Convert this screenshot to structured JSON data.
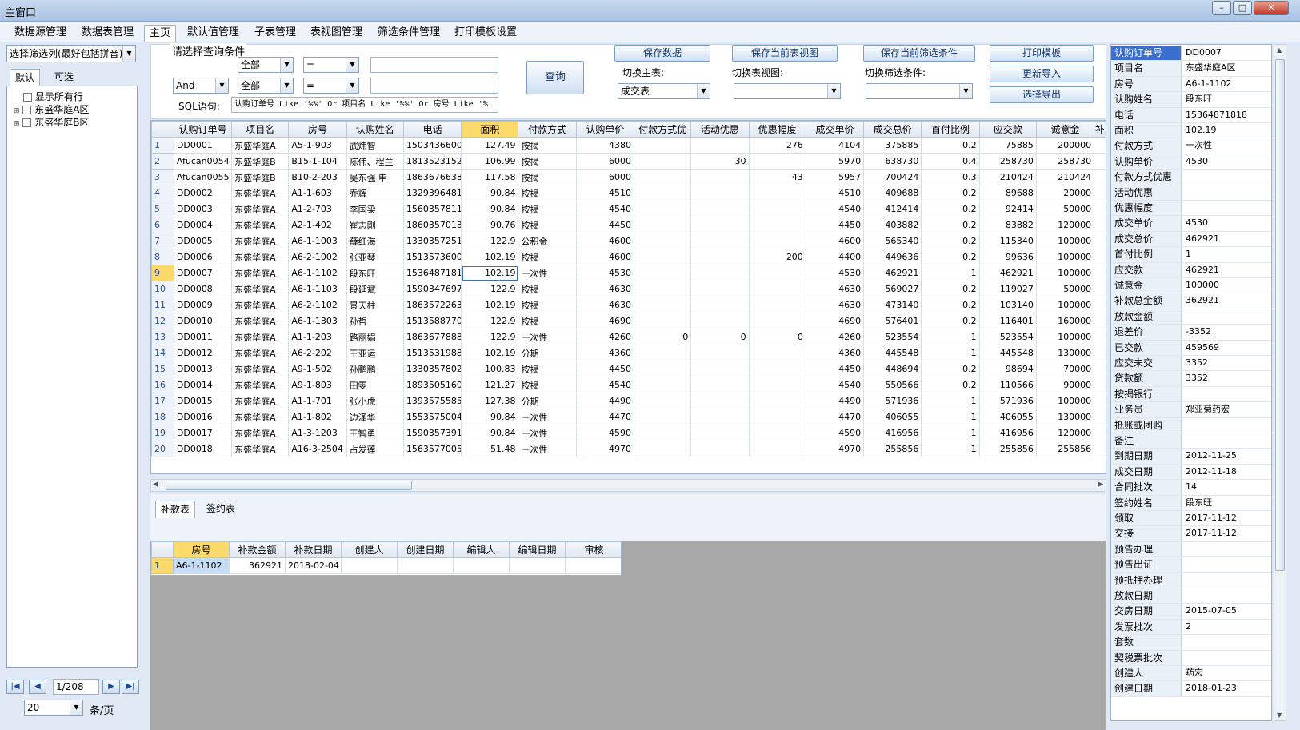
{
  "window": {
    "title": "主窗口"
  },
  "menu": {
    "items": [
      "数据源管理",
      "数据表管理",
      "主页",
      "默认值管理",
      "子表管理",
      "表视图管理",
      "筛选条件管理",
      "打印模板设置"
    ],
    "active": 2
  },
  "left": {
    "filter_select": "选择筛选列(最好包括拼音)",
    "tabs": [
      "默认",
      "可选"
    ],
    "tree": [
      "显示所有行",
      "东盛华庭A区",
      "东盛华庭B区"
    ],
    "pager": {
      "page": "1/208",
      "page_size": "20",
      "unit": "条/页"
    }
  },
  "query": {
    "legend": "请选择查询条件",
    "row1": {
      "field": "全部",
      "op": "=",
      "value": ""
    },
    "row2": {
      "logic": "And",
      "field": "全部",
      "op": "=",
      "value": ""
    },
    "sql_label": "SQL语句:",
    "sql_value": "认购订单号 Like '%%' Or 项目名 Like '%%' Or 房号 Like '%",
    "query_button": "查询"
  },
  "toolbar": {
    "save_data": "保存数据",
    "save_view": "保存当前表视图",
    "save_filter": "保存当前筛选条件",
    "print_template": "打印模板",
    "update_import": "更新导入",
    "select_export": "选择导出",
    "switch_main_label": "切换主表:",
    "switch_main_value": "成交表",
    "switch_view_label": "切换表视图:",
    "switch_view_value": "",
    "switch_filter_label": "切换筛选条件:",
    "switch_filter_value": ""
  },
  "grid": {
    "columns": [
      "认购订单号",
      "项目名",
      "房号",
      "认购姓名",
      "电话",
      "面积",
      "付款方式",
      "认购单价",
      "付款方式优",
      "活动优惠",
      "优惠幅度",
      "成交单价",
      "成交总价",
      "首付比例",
      "应交款",
      "诚意金",
      "补款总金"
    ],
    "highlight_col": 5,
    "current_row": 9,
    "rows": [
      [
        "1",
        "DD0001",
        "东盛华庭A",
        "A5-1-903",
        "武炜智",
        "1503436600",
        "127.49",
        "按揭",
        "4380",
        "",
        "",
        "276",
        "4104",
        "375885",
        "0.2",
        "75885",
        "200000",
        "8"
      ],
      [
        "2",
        "Afucan0054",
        "东盛华庭B",
        "B15-1-104",
        "陈伟、程兰",
        "1813523152",
        "106.99",
        "按揭",
        "6000",
        "",
        "30",
        "",
        "5970",
        "638730",
        "0.4",
        "258730",
        "258730",
        ""
      ],
      [
        "3",
        "Afucan0055",
        "东盛华庭B",
        "B10-2-203",
        "吴东强 申",
        "1863676638",
        "117.58",
        "按揭",
        "6000",
        "",
        "",
        "43",
        "5957",
        "700424",
        "0.3",
        "210424",
        "210424",
        ""
      ],
      [
        "4",
        "DD0002",
        "东盛华庭A",
        "A1-1-603",
        "乔辉",
        "1329396481",
        "90.84",
        "按揭",
        "4510",
        "",
        "",
        "",
        "4510",
        "409688",
        "0.2",
        "89688",
        "20000",
        "229"
      ],
      [
        "5",
        "DD0003",
        "东盛华庭A",
        "A1-2-703",
        "李国梁",
        "1560357811",
        "90.84",
        "按揭",
        "4540",
        "",
        "",
        "",
        "4540",
        "412414",
        "0.2",
        "92414",
        "50000",
        "82"
      ],
      [
        "6",
        "DD0004",
        "东盛华庭A",
        "A2-1-402",
        "崔志刚",
        "1860357013",
        "90.76",
        "按揭",
        "4450",
        "",
        "",
        "",
        "4450",
        "403882",
        "0.2",
        "83882",
        "120000",
        "3"
      ],
      [
        "7",
        "DD0005",
        "东盛华庭A",
        "A6-1-1003",
        "薛红海",
        "1330357251",
        "122.9",
        "公积金",
        "4600",
        "",
        "",
        "",
        "4600",
        "565340",
        "0.2",
        "115340",
        "100000",
        "165"
      ],
      [
        "8",
        "DD0006",
        "东盛华庭A",
        "A6-2-1002",
        "张亚琴",
        "1513573600",
        "102.19",
        "按揭",
        "4600",
        "",
        "",
        "200",
        "4400",
        "449636",
        "0.2",
        "99636",
        "100000",
        "199"
      ],
      [
        "9",
        "DD0007",
        "东盛华庭A",
        "A6-1-1102",
        "段东旺",
        "1536487181",
        "102.19",
        "一次性",
        "4530",
        "",
        "",
        "",
        "4530",
        "462921",
        "1",
        "462921",
        "100000",
        "362"
      ],
      [
        "10",
        "DD0008",
        "东盛华庭A",
        "A6-1-1103",
        "段延斌",
        "1590347697",
        "122.9",
        "按揭",
        "4630",
        "",
        "",
        "",
        "4630",
        "569027",
        "0.2",
        "119027",
        "50000",
        "129"
      ],
      [
        "11",
        "DD0009",
        "东盛华庭A",
        "A6-2-1102",
        "景天柱",
        "1863572263",
        "102.19",
        "按揭",
        "4630",
        "",
        "",
        "",
        "4630",
        "473140",
        "0.2",
        "103140",
        "100000",
        "43"
      ],
      [
        "12",
        "DD0010",
        "东盛华庭A",
        "A6-1-1303",
        "孙哲",
        "1513588770",
        "122.9",
        "按揭",
        "4690",
        "",
        "",
        "",
        "4690",
        "576401",
        "0.2",
        "116401",
        "160000",
        "216"
      ],
      [
        "13",
        "DD0011",
        "东盛华庭A",
        "A1-1-203",
        "路丽娟",
        "1863677888",
        "122.9",
        "一次性",
        "4260",
        "0",
        "0",
        "0",
        "4260",
        "523554",
        "1",
        "523554",
        "100000",
        "423"
      ],
      [
        "14",
        "DD0012",
        "东盛华庭A",
        "A6-2-202",
        "王亚运",
        "1513531988",
        "102.19",
        "分期",
        "4360",
        "",
        "",
        "",
        "4360",
        "445548",
        "1",
        "445548",
        "130000",
        "312"
      ],
      [
        "15",
        "DD0013",
        "东盛华庭A",
        "A9-1-502",
        "孙鹏鹏",
        "1330357802",
        "100.83",
        "按揭",
        "4450",
        "",
        "",
        "",
        "4450",
        "448694",
        "0.2",
        "98694",
        "70000",
        "71"
      ],
      [
        "16",
        "DD0014",
        "东盛华庭A",
        "A9-1-803",
        "田雯",
        "1893505160",
        "121.27",
        "按揭",
        "4540",
        "",
        "",
        "",
        "4540",
        "550566",
        "0.2",
        "110566",
        "90000",
        "83"
      ],
      [
        "17",
        "DD0015",
        "东盛华庭A",
        "A1-1-701",
        "张小虎",
        "1393575585",
        "127.38",
        "分期",
        "4490",
        "",
        "",
        "",
        "4490",
        "571936",
        "1",
        "571936",
        "100000",
        "468"
      ],
      [
        "18",
        "DD0016",
        "东盛华庭A",
        "A1-1-802",
        "边泽华",
        "1553575004",
        "90.84",
        "一次性",
        "4470",
        "",
        "",
        "",
        "4470",
        "406055",
        "1",
        "406055",
        "130000",
        "276"
      ],
      [
        "19",
        "DD0017",
        "东盛华庭A",
        "A1-3-1203",
        "王智勇",
        "1590357391",
        "90.84",
        "一次性",
        "4590",
        "",
        "",
        "",
        "4590",
        "416956",
        "1",
        "416956",
        "120000",
        "296"
      ],
      [
        "20",
        "DD0018",
        "东盛华庭A",
        "A16-3-2504",
        "占发莲",
        "1563577005",
        "51.48",
        "一次性",
        "4970",
        "",
        "",
        "",
        "4970",
        "255856",
        "1",
        "255856",
        "255856",
        ""
      ]
    ]
  },
  "subtabs": [
    "补款表",
    "签约表"
  ],
  "subgrid": {
    "columns": [
      "房号",
      "补款金额",
      "补款日期",
      "创建人",
      "创建日期",
      "编辑人",
      "编辑日期",
      "审核"
    ],
    "rows": [
      [
        "1",
        "A6-1-1102",
        "362921",
        "2018-02-04",
        "",
        "",
        "",
        "",
        ""
      ]
    ]
  },
  "detail": [
    [
      "认购订单号",
      "DD0007"
    ],
    [
      "项目名",
      "东盛华庭A区"
    ],
    [
      "房号",
      "A6-1-1102"
    ],
    [
      "认购姓名",
      "段东旺"
    ],
    [
      "电话",
      "15364871818"
    ],
    [
      "面积",
      "102.19"
    ],
    [
      "付款方式",
      "一次性"
    ],
    [
      "认购单价",
      "4530"
    ],
    [
      "付款方式优惠",
      ""
    ],
    [
      "活动优惠",
      ""
    ],
    [
      "优惠幅度",
      ""
    ],
    [
      "成交单价",
      "4530"
    ],
    [
      "成交总价",
      "462921"
    ],
    [
      "首付比例",
      "1"
    ],
    [
      "应交款",
      "462921"
    ],
    [
      "诚意金",
      "100000"
    ],
    [
      "补款总金额",
      "362921"
    ],
    [
      "放款金额",
      ""
    ],
    [
      "退差价",
      "-3352"
    ],
    [
      "已交款",
      "459569"
    ],
    [
      "应交未交",
      "3352"
    ],
    [
      "贷款额",
      "3352"
    ],
    [
      "按揭银行",
      ""
    ],
    [
      "业务员",
      "郑亚菊药宏"
    ],
    [
      "抵账或团购",
      ""
    ],
    [
      "备注",
      ""
    ],
    [
      "到期日期",
      "2012-11-25"
    ],
    [
      "成交日期",
      "2012-11-18"
    ],
    [
      "合同批次",
      "14"
    ],
    [
      "签约姓名",
      "段东旺"
    ],
    [
      "领取",
      "2017-11-12"
    ],
    [
      "交接",
      "2017-11-12"
    ],
    [
      "预告办理",
      ""
    ],
    [
      "预告出证",
      ""
    ],
    [
      "预抵押办理",
      ""
    ],
    [
      "放款日期",
      ""
    ],
    [
      "交房日期",
      "2015-07-05"
    ],
    [
      "发票批次",
      "2"
    ],
    [
      "套数",
      ""
    ],
    [
      "契税票批次",
      ""
    ],
    [
      "创建人",
      "药宏"
    ],
    [
      "创建日期",
      "2018-01-23"
    ]
  ]
}
